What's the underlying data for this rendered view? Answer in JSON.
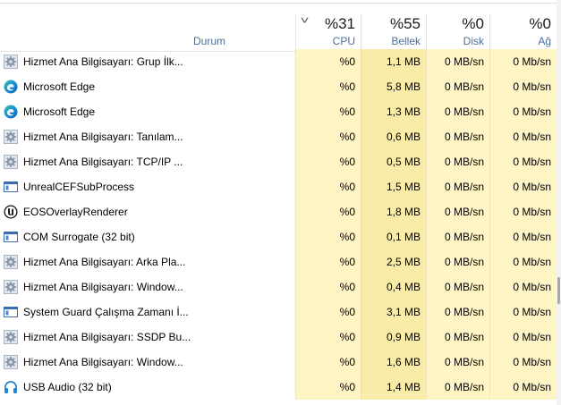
{
  "header": {
    "sort_indicator": "˅",
    "status_label": "Durum",
    "cpu": {
      "percent": "%31",
      "label": "CPU"
    },
    "memory": {
      "percent": "%55",
      "label": "Bellek"
    },
    "disk": {
      "percent": "%0",
      "label": "Disk"
    },
    "network": {
      "percent": "%0",
      "label": "Ağ"
    }
  },
  "processes": [
    {
      "name": "Hizmet Ana Bilgisayarı: Grup İlk...",
      "icon": "gear-icon",
      "cpu": "%0",
      "memory": "1,1 MB",
      "disk": "0 MB/sn",
      "network": "0 Mb/sn"
    },
    {
      "name": "Microsoft Edge",
      "icon": "edge-icon",
      "cpu": "%0",
      "memory": "5,8 MB",
      "disk": "0 MB/sn",
      "network": "0 Mb/sn"
    },
    {
      "name": "Microsoft Edge",
      "icon": "edge-icon",
      "cpu": "%0",
      "memory": "1,3 MB",
      "disk": "0 MB/sn",
      "network": "0 Mb/sn"
    },
    {
      "name": "Hizmet Ana Bilgisayarı: Tanılam...",
      "icon": "gear-icon",
      "cpu": "%0",
      "memory": "0,6 MB",
      "disk": "0 MB/sn",
      "network": "0 Mb/sn"
    },
    {
      "name": "Hizmet Ana Bilgisayarı: TCP/IP ...",
      "icon": "gear-icon",
      "cpu": "%0",
      "memory": "0,5 MB",
      "disk": "0 MB/sn",
      "network": "0 Mb/sn"
    },
    {
      "name": "UnrealCEFSubProcess",
      "icon": "window-icon",
      "cpu": "%0",
      "memory": "1,5 MB",
      "disk": "0 MB/sn",
      "network": "0 Mb/sn"
    },
    {
      "name": "EOSOverlayRenderer",
      "icon": "unreal-icon",
      "cpu": "%0",
      "memory": "1,8 MB",
      "disk": "0 MB/sn",
      "network": "0 Mb/sn"
    },
    {
      "name": "COM Surrogate (32 bit)",
      "icon": "window-icon",
      "cpu": "%0",
      "memory": "0,1 MB",
      "disk": "0 MB/sn",
      "network": "0 Mb/sn"
    },
    {
      "name": "Hizmet Ana Bilgisayarı: Arka Pla...",
      "icon": "gear-icon",
      "cpu": "%0",
      "memory": "2,5 MB",
      "disk": "0 MB/sn",
      "network": "0 Mb/sn"
    },
    {
      "name": "Hizmet Ana Bilgisayarı: Window...",
      "icon": "gear-icon",
      "cpu": "%0",
      "memory": "0,4 MB",
      "disk": "0 MB/sn",
      "network": "0 Mb/sn"
    },
    {
      "name": "System Guard Çalışma Zamanı İ...",
      "icon": "window-icon",
      "cpu": "%0",
      "memory": "3,1 MB",
      "disk": "0 MB/sn",
      "network": "0 Mb/sn"
    },
    {
      "name": "Hizmet Ana Bilgisayarı: SSDP Bu...",
      "icon": "gear-icon",
      "cpu": "%0",
      "memory": "0,9 MB",
      "disk": "0 MB/sn",
      "network": "0 Mb/sn"
    },
    {
      "name": "Hizmet Ana Bilgisayarı: Window...",
      "icon": "gear-icon",
      "cpu": "%0",
      "memory": "1,6 MB",
      "disk": "0 MB/sn",
      "network": "0 Mb/sn"
    },
    {
      "name": "USB Audio (32 bit)",
      "icon": "headphones-icon",
      "cpu": "%0",
      "memory": "1,4 MB",
      "disk": "0 MB/sn",
      "network": "0 Mb/sn"
    }
  ],
  "colors": {
    "heat_light": "#fff4c4",
    "heat_memory": "#f9eca8",
    "header_label": "#4a6f9a"
  }
}
